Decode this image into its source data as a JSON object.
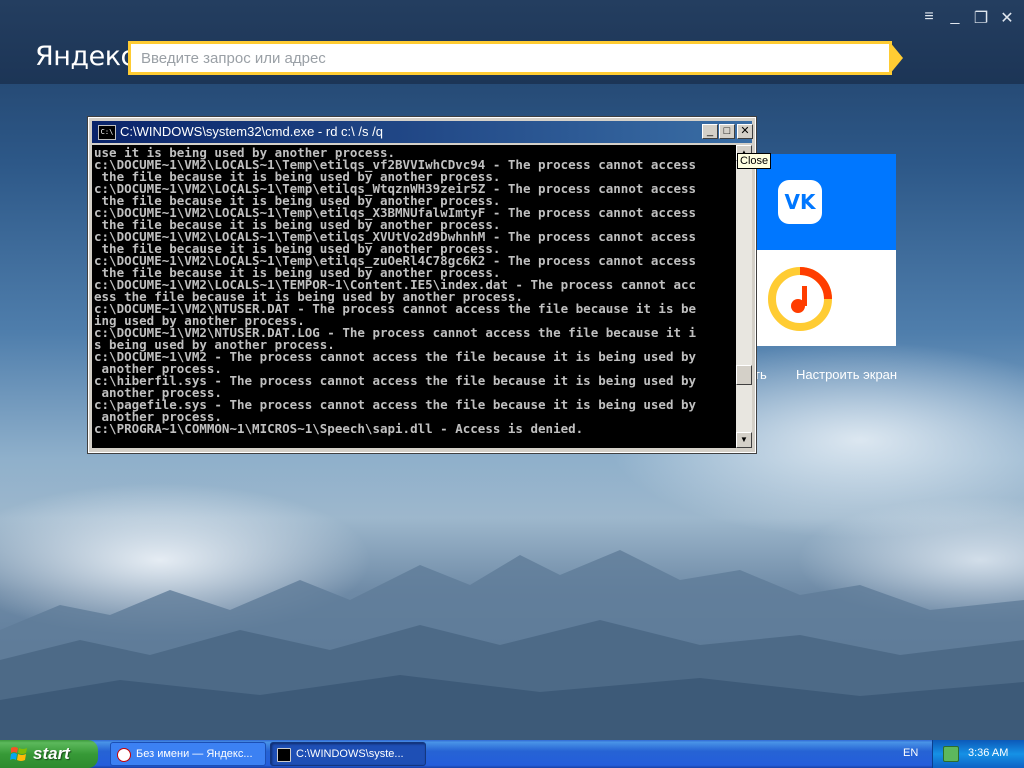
{
  "browser": {
    "logo": "Яндекс",
    "omnibox_placeholder": "Введите запрос или адрес",
    "window_buttons": [
      "menu-icon",
      "minimize-icon",
      "restore-icon",
      "close-icon"
    ],
    "accent_color": "#ffcc33",
    "tiles": [
      {
        "name": "VK",
        "glyph": "VK",
        "color": "#0077ff"
      },
      {
        "name": "Yandex Music",
        "icon": "music-icon",
        "color": "#ffffff"
      }
    ],
    "partial_link": "ть",
    "customize_link": "Настроить экран"
  },
  "cmd": {
    "title": "C:\\WINDOWS\\system32\\cmd.exe - rd c:\\ /s /q",
    "icon_label": "C:\\",
    "tooltip": "Close",
    "lines": [
      "use it is being used by another process.",
      "c:\\DOCUME~1\\VM2\\LOCALS~1\\Temp\\etilqs_vf2BVVIwhCDvc94 - The process cannot access",
      " the file because it is being used by another process.",
      "c:\\DOCUME~1\\VM2\\LOCALS~1\\Temp\\etilqs_WtqznWH39zeir5Z - The process cannot access",
      " the file because it is being used by another process.",
      "c:\\DOCUME~1\\VM2\\LOCALS~1\\Temp\\etilqs_X3BMNUfalwImtyF - The process cannot access",
      " the file because it is being used by another process.",
      "c:\\DOCUME~1\\VM2\\LOCALS~1\\Temp\\etilqs_XVUtVo2d9DwhnhM - The process cannot access",
      " the file because it is being used by another process.",
      "c:\\DOCUME~1\\VM2\\LOCALS~1\\Temp\\etilqs_zuOeRl4C78gc6K2 - The process cannot access",
      " the file because it is being used by another process.",
      "c:\\DOCUME~1\\VM2\\LOCALS~1\\TEMPOR~1\\Content.IE5\\index.dat - The process cannot acc",
      "ess the file because it is being used by another process.",
      "c:\\DOCUME~1\\VM2\\NTUSER.DAT - The process cannot access the file because it is be",
      "ing used by another process.",
      "c:\\DOCUME~1\\VM2\\NTUSER.DAT.LOG - The process cannot access the file because it i",
      "s being used by another process.",
      "c:\\DOCUME~1\\VM2 - The process cannot access the file because it is being used by",
      " another process.",
      "c:\\hiberfil.sys - The process cannot access the file because it is being used by",
      " another process.",
      "c:\\pagefile.sys - The process cannot access the file because it is being used by",
      " another process.",
      "c:\\PROGRA~1\\COMMON~1\\MICROS~1\\Speech\\sapi.dll - Access is denied."
    ]
  },
  "taskbar": {
    "start_label": "start",
    "tasks": [
      {
        "label": "Без имени — Яндекс...",
        "icon": "yandex-browser-icon"
      },
      {
        "label": "C:\\WINDOWS\\syste...",
        "icon": "cmd-icon"
      }
    ],
    "language": "EN",
    "clock": "3:36 AM"
  }
}
